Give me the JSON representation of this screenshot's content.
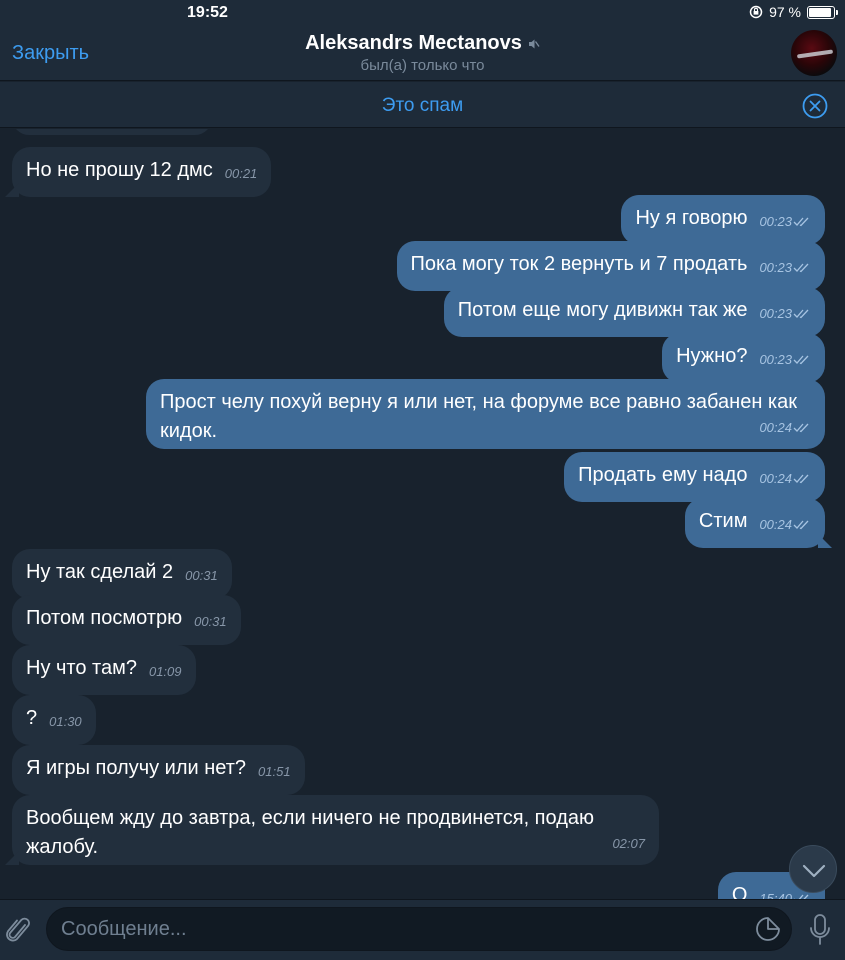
{
  "status": {
    "time": "19:52",
    "battery_text": "97 %",
    "battery_level": 0.97
  },
  "nav": {
    "close_label": "Закрыть",
    "title": "Aleksandrs Mectanovs",
    "subtitle": "был(а) только что",
    "muted_icon": "mute-icon"
  },
  "spam": {
    "label": "Это спам"
  },
  "colors": {
    "accent": "#3d9cf0",
    "bubble_out": "#3e6a96",
    "bubble_in": "#222f3d",
    "background": "#18222d"
  },
  "messages": [
    {
      "text": "Но не прошу 12 дмс",
      "time": "00:21",
      "dir": "in"
    },
    {
      "text": "Ну я говорю",
      "time": "00:23",
      "dir": "out"
    },
    {
      "text": "Пока могу ток 2 вернуть и 7 продать",
      "time": "00:23",
      "dir": "out"
    },
    {
      "text": "Потом еще могу дивижн так же",
      "time": "00:23",
      "dir": "out"
    },
    {
      "text": "Нужно?",
      "time": "00:23",
      "dir": "out"
    },
    {
      "text": "Прост челу похуй верну я или нет, на форуме все равно забанен как кидок.",
      "time": "00:24",
      "dir": "out"
    },
    {
      "text": "Продать ему надо",
      "time": "00:24",
      "dir": "out"
    },
    {
      "text": "Стим",
      "time": "00:24",
      "dir": "out"
    },
    {
      "text": "Ну так сделай 2",
      "time": "00:31",
      "dir": "in"
    },
    {
      "text": "Потом посмотрю",
      "time": "00:31",
      "dir": "in"
    },
    {
      "text": "Ну что там?",
      "time": "01:09",
      "dir": "in"
    },
    {
      "text": "?",
      "time": "01:30",
      "dir": "in"
    },
    {
      "text": "Я игры получу или нет?",
      "time": "01:51",
      "dir": "in"
    },
    {
      "text": "Вообщем жду до завтра, если ничего не продвинется, подаю жалобу.",
      "time": "02:07",
      "dir": "in"
    },
    {
      "text": "О",
      "time": "15:40",
      "dir": "out"
    }
  ],
  "composer": {
    "placeholder": "Сообщение..."
  }
}
